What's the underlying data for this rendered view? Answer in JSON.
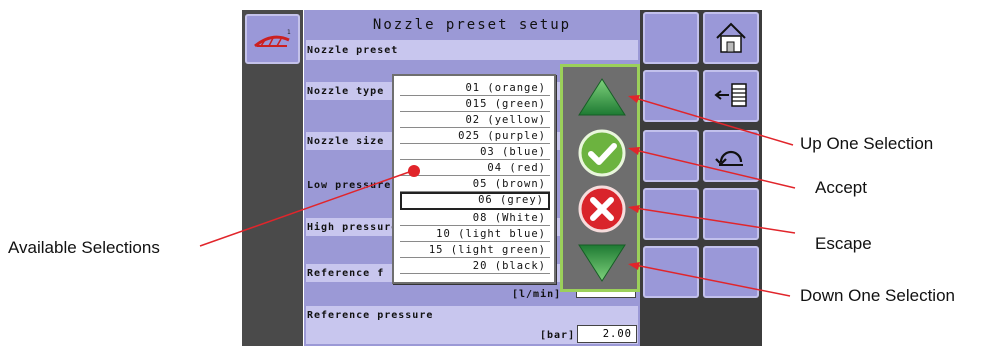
{
  "screen": {
    "title": "Nozzle preset setup",
    "rows": [
      {
        "label": "Nozzle preset"
      },
      {
        "label": "Nozzle type"
      },
      {
        "label": "Nozzle size"
      },
      {
        "label": "Low pressure"
      },
      {
        "label": "High pressure"
      },
      {
        "label": "Reference f"
      },
      {
        "label": "Reference pressure"
      }
    ],
    "ref_flow_unit": "[l/min]",
    "ref_pressure_unit": "[bar]",
    "ref_pressure_value": "2.00"
  },
  "dropdown": {
    "options": [
      "01 (orange)",
      "015 (green)",
      "02 (yellow)",
      "025 (purple)",
      "03 (blue)",
      "04 (red)",
      "05 (brown)",
      "06 (grey)",
      "08 (White)",
      "10 (light blue)",
      "15 (light green)",
      "20 (black)"
    ],
    "selected": "06 (grey)"
  },
  "callouts": {
    "up": "Up One Selection",
    "accept": "Accept",
    "escape": "Escape",
    "down": "Down One Selection",
    "available": "Available Selections"
  },
  "colors": {
    "panel": "#9b99d6",
    "button": "#9a98d8",
    "accept": "#6cb33f",
    "escape": "#d9242b",
    "arrow": "#3a9a47",
    "nav_border": "#9bd05a",
    "callout_line": "#e1252b"
  },
  "icons": {
    "sprayer": "sprayer-icon",
    "home": "home-icon",
    "menu": "menu-list-icon",
    "back": "back-icon"
  }
}
